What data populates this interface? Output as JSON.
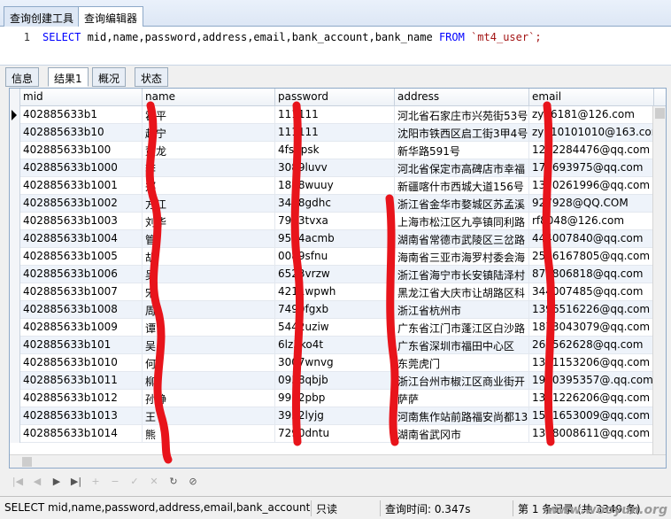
{
  "tabs": [
    "查询创建工具",
    "查询编辑器"
  ],
  "editor": {
    "line": "1",
    "sql_kw1": "SELECT",
    "sql_cols": " mid,name,password,address,email,bank_account,bank_name ",
    "sql_kw2": "FROM",
    "sql_table": " `mt4_user`;"
  },
  "result_tabs": [
    "信息",
    "结果1",
    "概况",
    "状态"
  ],
  "columns": [
    "mid",
    "name",
    "password",
    "address",
    "email"
  ],
  "rows": [
    [
      "402885633b1",
      "霍平",
      "111111",
      "河北省石家庄市兴苑街53号",
      "zyp6181@126.com"
    ],
    [
      "402885633b10",
      "赵宁",
      "111111",
      "沈阳市铁西区启工街3甲4号",
      "zyn10101010@163.com"
    ],
    [
      "402885633b100",
      "董龙",
      "4fsqpsk",
      "新华路591号",
      "1272284476@qq.com"
    ],
    [
      "402885633b1000",
      "李",
      "3089luvv",
      "河北省保定市高碑店市幸福",
      "174693975@qq.com"
    ],
    [
      "402885633b1001",
      "郑",
      "1838wuuy",
      "新疆喀什市西城大道156号",
      "1370261996@qq.com"
    ],
    [
      "402885633b1002",
      "方江",
      "3468gdhc",
      "浙江省金华市婺城区苏孟溪",
      "927928@QQ.COM"
    ],
    [
      "402885633b1003",
      "刘华",
      "7943tvxa",
      "上海市松江区九亭镇同利路",
      "rf8048@126.com"
    ],
    [
      "402885633b1004",
      "管",
      "9514acmb",
      "湖南省常德市武陵区三岔路",
      "444007840@qq.com"
    ],
    [
      "402885633b1005",
      "胡",
      "0089sfnu",
      "海南省三亚市海罗村委会海",
      "2536167805@qq.com"
    ],
    [
      "402885633b1006",
      "吴",
      "6523vrzw",
      "浙江省海宁市长安镇陆泽村",
      "879806818@qq.com"
    ],
    [
      "402885633b1007",
      "宋",
      "4211wpwh",
      "黑龙江省大庆市让胡路区科",
      "344007485@qq.com"
    ],
    [
      "402885633b1008",
      "周",
      "7499fgxb",
      "浙江省杭州市",
      "1396516226@qq.com"
    ],
    [
      "402885633b1009",
      "谭",
      "5442uziw",
      "广东省江门市蓬江区白沙路",
      "1873043079@qq.com"
    ],
    [
      "402885633b101",
      "吴",
      "6lz5ko4t",
      "广东省深圳市福田中心区",
      "269562628@qq.com"
    ],
    [
      "402885633b1010",
      "何",
      "3007wnvg",
      "东莞虎门",
      "1371153206@qq.com"
    ],
    [
      "402885633b1011",
      "柳",
      "0958qbjb",
      "浙江台州市椒江区商业街开",
      "1910395357@.qq.com"
    ],
    [
      "402885633b1012",
      "孙静",
      "9952pbp",
      "萨萨",
      "1371226206@qq.com"
    ],
    [
      "402885633b1013",
      "王",
      "3952lyjg",
      "河南焦作站前路福安尚都13",
      "1551653009@qq.com"
    ],
    [
      "402885633b1014",
      "熊",
      "7290dntu",
      "湖南省武冈市",
      "1378008611@qq.com"
    ]
  ],
  "nav_icons": [
    "first-icon",
    "prev-icon",
    "play-icon",
    "last-icon",
    "add-icon",
    "delete-icon",
    "apply-icon",
    "cancel-icon",
    "refresh-icon",
    "stop-icon"
  ],
  "status": {
    "sql": "SELECT mid,name,password,address,email,bank_account,ba",
    "mode": "只读",
    "time": "查询时间: 0.347s",
    "records": "第 1 条记录 (共 3349 条)"
  },
  "watermark": "www.wooyun.org",
  "colors": {
    "tab_border": "#8ea9c8",
    "alt_row": "#eef3fa",
    "scribble": "#e8141b"
  }
}
